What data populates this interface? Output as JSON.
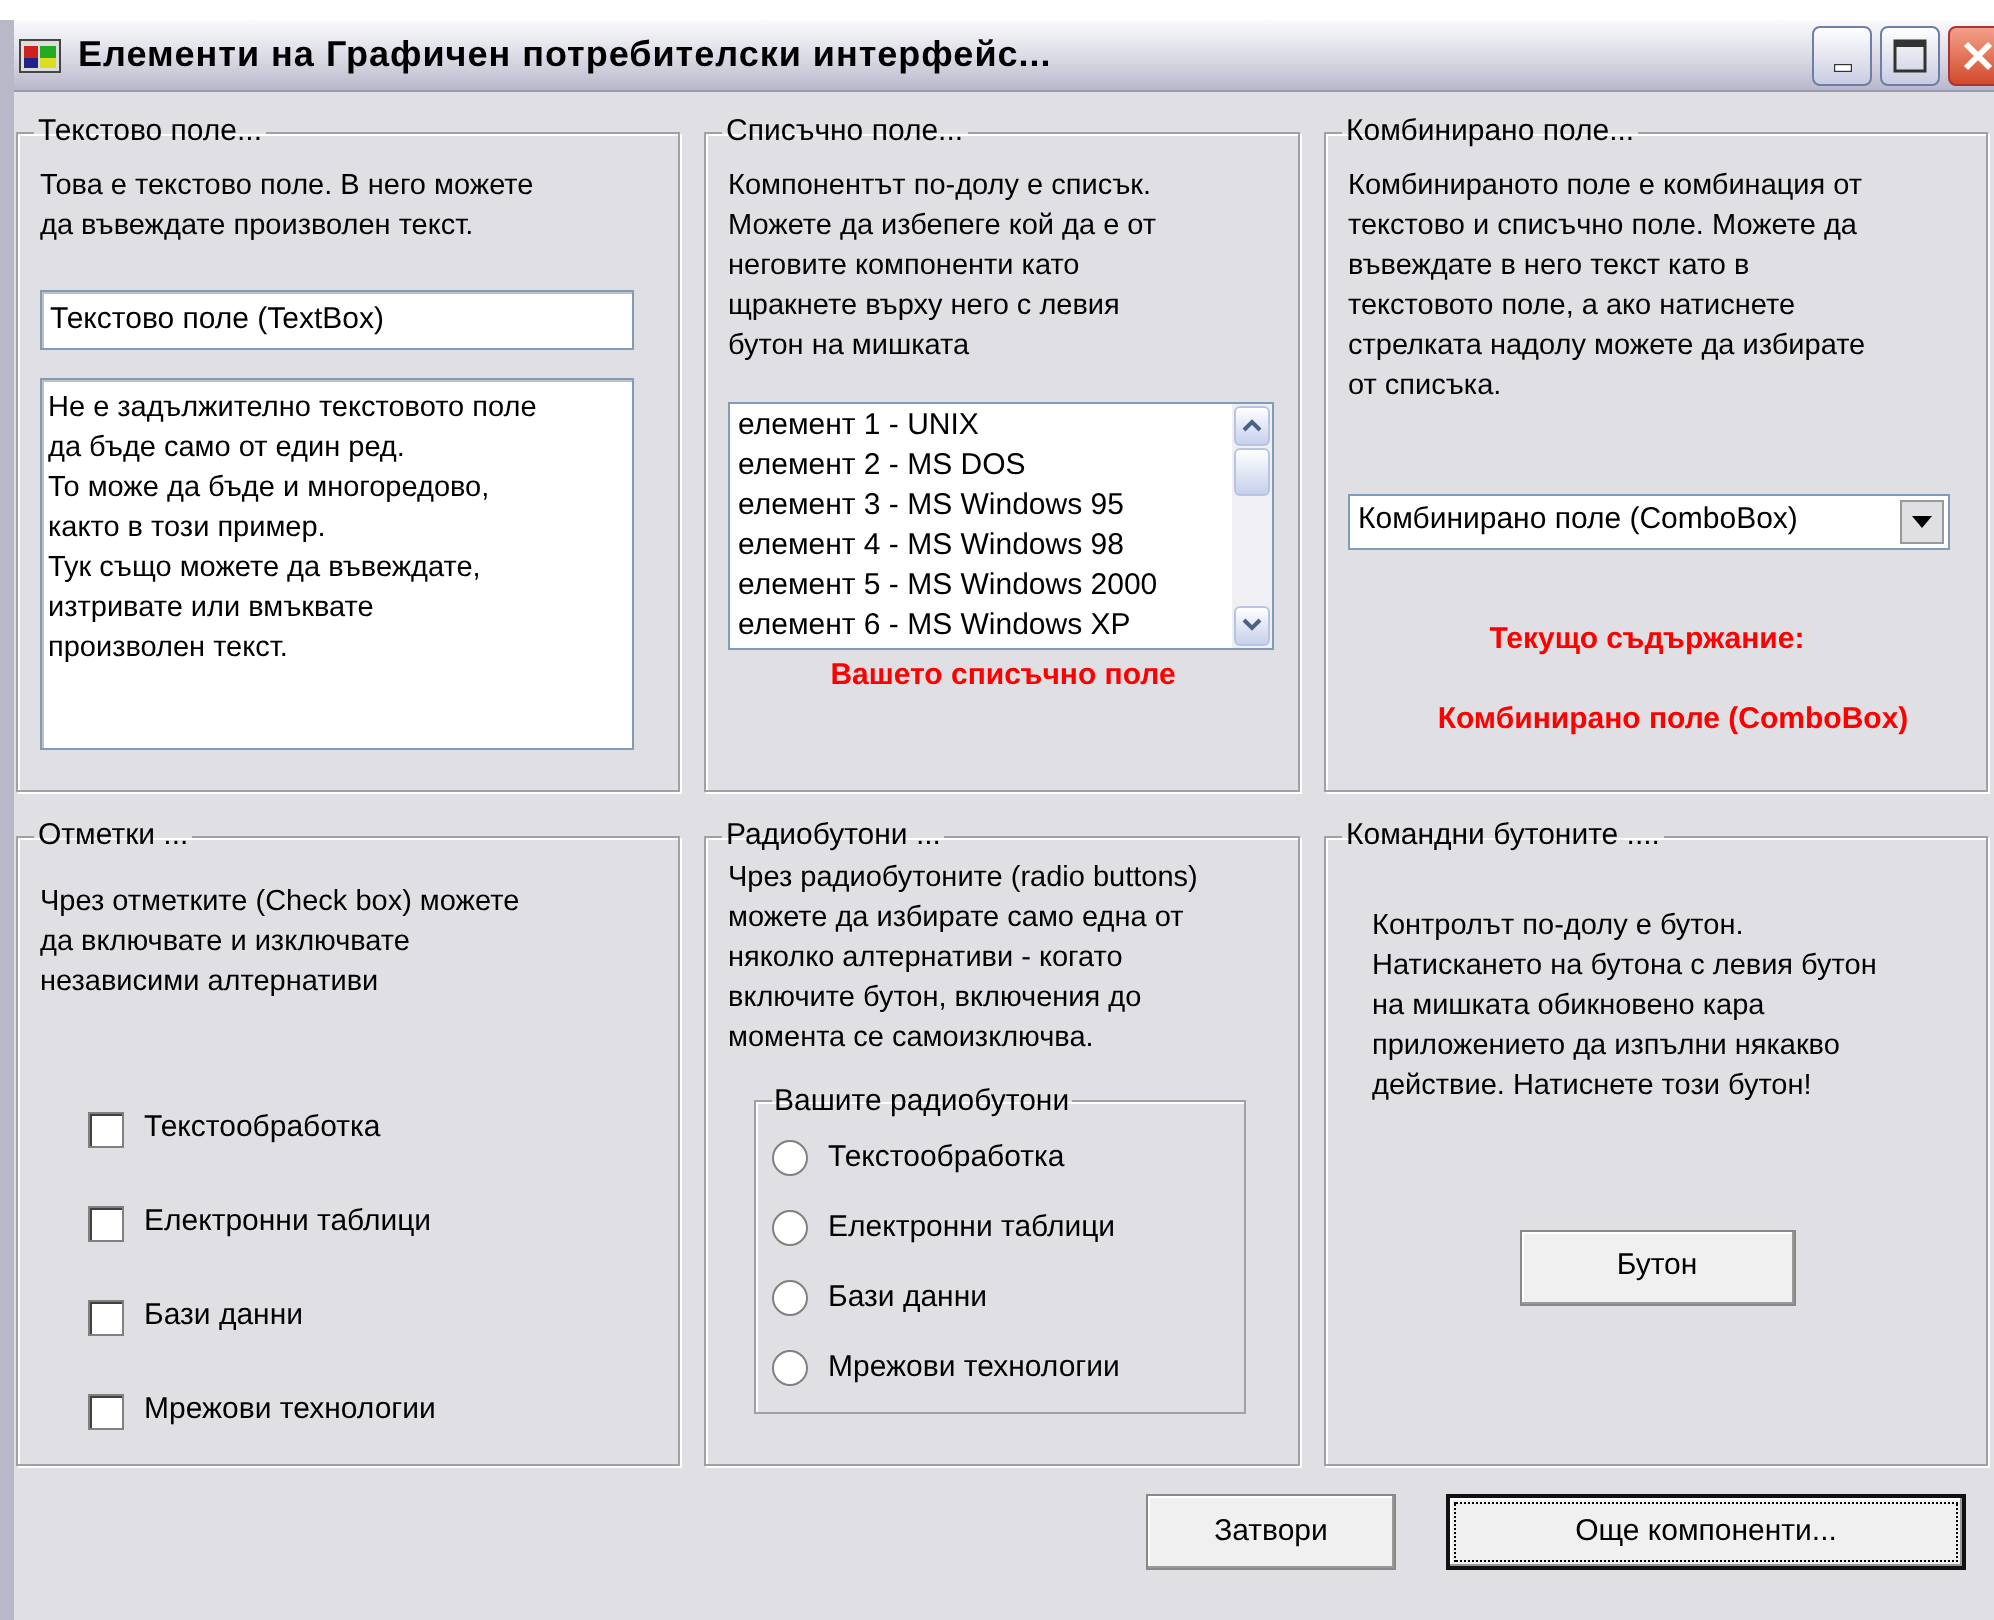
{
  "window": {
    "title": "Елементи на Графичен потребителски интерфейс..."
  },
  "text_group": {
    "legend": "Текстово поле...",
    "description": [
      "Това е текстово поле. В него можете",
      "да въвеждате произволен текст."
    ],
    "textbox": {
      "value": "Текстово поле (TextBox)"
    },
    "textarea": {
      "lines": [
        "Не е задължително текстовото поле",
        "да бъде само от един ред.",
        "То може да бъде и многоредово,",
        "както в този пример.",
        "Тук също можете да въвеждате,",
        "изтривате или вмъквате",
        "произволен текст."
      ]
    }
  },
  "list_group": {
    "legend": "Списъчно поле...",
    "description": [
      "Компонентът по-долу е списък.",
      "Можете да избепеге кой да е от",
      "неговите компоненти като",
      "щракнете върху него с левия",
      "бутон на мишката"
    ],
    "items": [
      {
        "label": "елемент 1 - UNIX",
        "selected": false
      },
      {
        "label": "елемент 2 - MS DOS",
        "selected": false
      },
      {
        "label": "елемент 3 - MS Windows 95",
        "selected": false
      },
      {
        "label": "елемент 4 - MS Windows 98",
        "selected": false
      },
      {
        "label": "елемент 5 - MS Windows 2000",
        "selected": false
      },
      {
        "label": "елемент 6 - MS Windows XP",
        "selected": false
      }
    ],
    "caption": "Вашето списъчно поле"
  },
  "combo_group": {
    "legend": "Комбинирано поле...",
    "description": [
      "Комбинираното поле е комбинация от",
      "текстово и списъчно поле. Можете да",
      "въвеждате в него текст като в",
      "текстовото поле, а ако натиснете",
      "стрелката надолу можете да избирате",
      "от списъка."
    ],
    "combo": {
      "value": "Комбинирано поле (ComboBox)"
    },
    "current_label": "Текущо съдържание:",
    "current_value": "Комбинирано поле (ComboBox)"
  },
  "checkbox_group": {
    "legend": "Отметки ...",
    "description": [
      "Чрез отметките (Check box) можете",
      "да включвате и изключвате",
      "независими алтернативи"
    ],
    "items": [
      {
        "label": "Текстообработка",
        "checked": false
      },
      {
        "label": "Електронни таблици",
        "checked": false
      },
      {
        "label": "Бази данни",
        "checked": false
      },
      {
        "label": "Мрежови технологии",
        "checked": false
      }
    ]
  },
  "radio_group": {
    "legend": "Радиобутони ...",
    "description": [
      "Чрез радиобутоните (radio buttons)",
      "можете да избирате само една от",
      "няколко алтернативи - когато",
      "включите бутон, включения до",
      "момента се самоизключва."
    ],
    "inner_legend": "Вашите радиобутони",
    "items": [
      {
        "label": "Текстообработка",
        "selected": false
      },
      {
        "label": "Електронни таблици",
        "selected": false
      },
      {
        "label": "Бази данни",
        "selected": false
      },
      {
        "label": "Мрежови технологии",
        "selected": false
      }
    ]
  },
  "command_group": {
    "legend": "Командни бутоните ....",
    "description": [
      "Контролът по-долу е бутон.",
      "Натискането на бутона с левия бутон",
      "на мишката обикновено кара",
      "приложението да изпълни някакво",
      "действие. Натиснете този бутон!"
    ],
    "button": "Бутон"
  },
  "footer_buttons": [
    {
      "label": "Затвори",
      "default": false
    },
    {
      "label": "Още компоненти...",
      "default": true
    }
  ]
}
